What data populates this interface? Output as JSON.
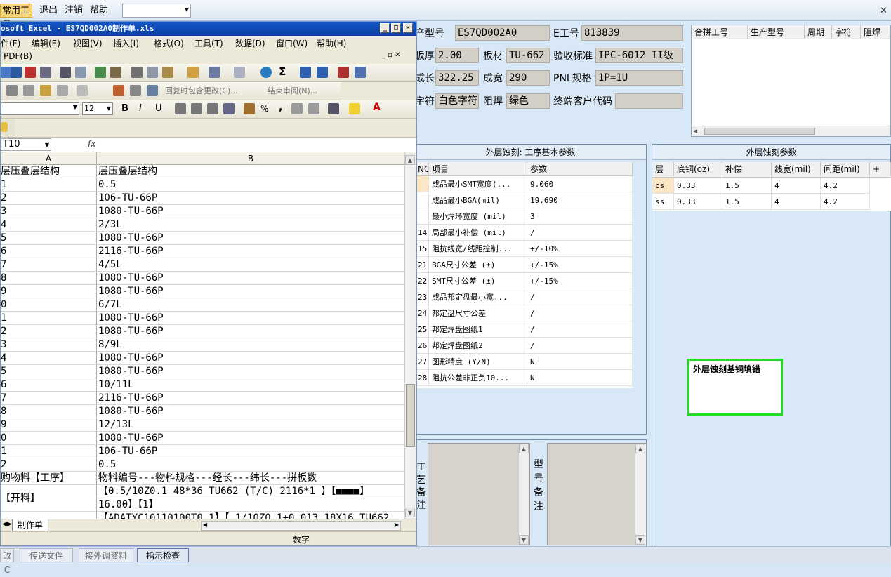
{
  "app_menu": {
    "items": [
      "常用工具",
      "退出",
      "注销",
      "帮助"
    ],
    "dropdown_value": ""
  },
  "excel": {
    "title": "osoft Excel - ES7QD002A0制作单.xls",
    "menu": [
      "件(F)",
      "编辑(E)",
      "视图(V)",
      "插入(I)",
      "格式(O)",
      "工具(T)",
      "数据(D)",
      "窗口(W)",
      "帮助(H)"
    ],
    "menu2": "PDF(B)",
    "review_text": "回复时包含更改(C)...",
    "end_review": "结束审阅(N)...",
    "font_size": "12",
    "name_box": "T10",
    "fx": "fx",
    "col_a": "A",
    "col_b": "B",
    "rows": [
      [
        "层压叠层结构",
        "层压叠层结构"
      ],
      [
        "1",
        "0.5"
      ],
      [
        "2",
        "106-TU-66P"
      ],
      [
        "3",
        "1080-TU-66P"
      ],
      [
        "4",
        "2/3L"
      ],
      [
        "5",
        "1080-TU-66P"
      ],
      [
        "6",
        "2116-TU-66P"
      ],
      [
        "7",
        "4/5L"
      ],
      [
        "8",
        "1080-TU-66P"
      ],
      [
        "9",
        "1080-TU-66P"
      ],
      [
        "0",
        "6/7L"
      ],
      [
        "1",
        "1080-TU-66P"
      ],
      [
        "2",
        "1080-TU-66P"
      ],
      [
        "3",
        "8/9L"
      ],
      [
        "4",
        "1080-TU-66P"
      ],
      [
        "5",
        "1080-TU-66P"
      ],
      [
        "6",
        "10/11L"
      ],
      [
        "7",
        "2116-TU-66P"
      ],
      [
        "8",
        "1080-TU-66P"
      ],
      [
        "9",
        "12/13L"
      ],
      [
        "0",
        "1080-TU-66P"
      ],
      [
        "1",
        "106-TU-66P"
      ],
      [
        "2",
        "0.5"
      ],
      [
        "购物料【工序】",
        "物料编号---物料规格---经长---纬长---拼板数"
      ]
    ],
    "row_kailiao_a": "【开料】",
    "row_kailiao_b1": "【0.5/10Z0.1 48*36  TU662 (T/C) 2116*1 】【■■■■】",
    "row_kailiao_b2": "16.00】【1】",
    "row_last_b": "【ADATYC10110100T0.1】【 1/10Z0.1+0.013 18X16  TU662",
    "sheet_tab": "制作单",
    "status_text": "数字"
  },
  "info": {
    "labels": {
      "model": "产型号",
      "eno": "E工号",
      "thickness": "板厚",
      "material": "板材",
      "standard": "验收标准",
      "length": "成长",
      "width": "成宽",
      "pnl": "PNL规格",
      "char": "字符",
      "mask": "阻焊",
      "customer": "终端客户代码"
    },
    "values": {
      "model": "ES7QD002A0",
      "eno": "813839",
      "thickness": "2.00",
      "material": "TU-662",
      "standard": "IPC-6012 II级",
      "length": "322.25",
      "width": "290",
      "pnl": "1P=1U",
      "char": "白色字符",
      "mask": "绿色",
      "customer": ""
    }
  },
  "combine_grid": {
    "headers": [
      "合拼工号",
      "生产型号",
      "周期",
      "字符",
      "阻焊"
    ]
  },
  "process_params": {
    "title": "外层蚀刻: 工序基本参数",
    "headers": [
      "NO",
      "项目",
      "参数"
    ],
    "rows": [
      [
        "",
        "成品最小SMT宽度(...",
        "9.060"
      ],
      [
        "",
        "成品最小BGA(mil)",
        "19.690"
      ],
      [
        "",
        "最小焊环宽度 (mil)",
        "3"
      ],
      [
        "14",
        "局部最小补偿 (mil)",
        "/"
      ],
      [
        "15",
        "阻抗线宽/线距控制...",
        "+/-10%"
      ],
      [
        "21",
        "BGA尺寸公差 (±)",
        "+/-15%"
      ],
      [
        "22",
        "SMT尺寸公差 (±)",
        "+/-15%"
      ],
      [
        "23",
        "成品邦定盘最小宽...",
        "/"
      ],
      [
        "24",
        "邦定盘尺寸公差",
        "/"
      ],
      [
        "25",
        "邦定焊盘图纸1",
        "/"
      ],
      [
        "26",
        "邦定焊盘图纸2",
        "/"
      ],
      [
        "27",
        "图形精度 (Y/N)",
        "N"
      ],
      [
        "28",
        "阻抗公差非正负10...",
        "N"
      ]
    ]
  },
  "etch_params": {
    "title": "外层蚀刻参数",
    "headers": [
      "层",
      "底铜(oz)",
      "补偿",
      "线宽(mil)",
      "间距(mil)",
      "+"
    ],
    "rows": [
      [
        "cs",
        "0.33",
        "1.5",
        "4",
        "4.2"
      ],
      [
        "ss",
        "0.33",
        "1.5",
        "4",
        "4.2"
      ]
    ],
    "warning": "外层蚀刻基铜填错"
  },
  "remarks": {
    "process_label": "工艺备注",
    "model_label": "型号备注"
  },
  "status_buttons": [
    "改C",
    "传送文件",
    "接外调资料",
    "指示检查"
  ],
  "colors": {
    "warning_border": "#22dd22",
    "title_bar": "#1456c6",
    "highlight_cell": "#fbe7c6"
  }
}
